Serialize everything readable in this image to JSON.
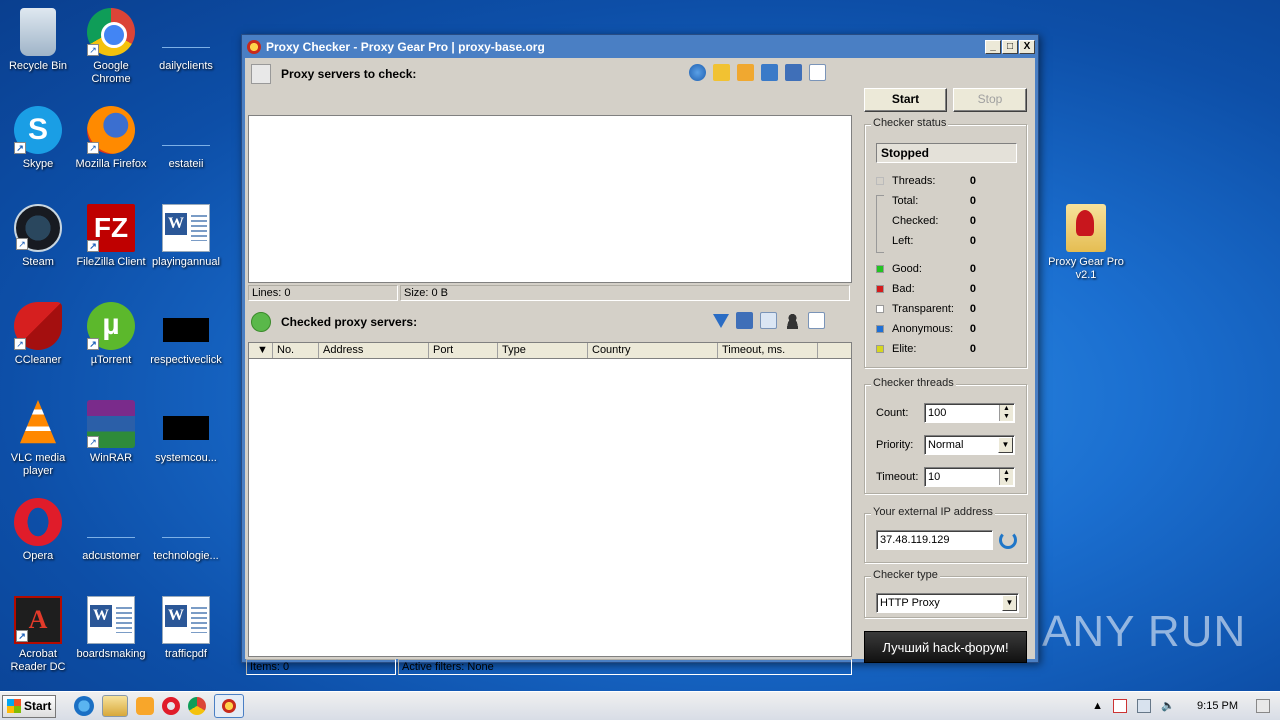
{
  "desktop": {
    "icons": [
      {
        "label": "Recycle Bin"
      },
      {
        "label": "Google Chrome"
      },
      {
        "label": "dailyclients"
      },
      {
        "label": "Skype"
      },
      {
        "label": "Mozilla Firefox"
      },
      {
        "label": "estateii"
      },
      {
        "label": "Steam"
      },
      {
        "label": "FileZilla Client"
      },
      {
        "label": "playingannual"
      },
      {
        "label": "CCleaner"
      },
      {
        "label": "µTorrent"
      },
      {
        "label": "respectiveclick"
      },
      {
        "label": "VLC media player"
      },
      {
        "label": "WinRAR"
      },
      {
        "label": "systemcou..."
      },
      {
        "label": "Opera"
      },
      {
        "label": "adcustomer"
      },
      {
        "label": "technologie..."
      },
      {
        "label": "Acrobat Reader DC"
      },
      {
        "label": "boardsmaking"
      },
      {
        "label": "trafficpdf"
      },
      {
        "label": "Proxy Gear Pro v2.1"
      }
    ]
  },
  "window": {
    "title": "Proxy Checker - Proxy Gear Pro | proxy-base.org",
    "controls": {
      "minimize": "_",
      "maximize": "□",
      "close": "X"
    }
  },
  "proxies_panel": {
    "title": "Proxy servers to check:",
    "status": {
      "lines": "Lines: 0",
      "size": "Size: 0 B"
    }
  },
  "checked_panel": {
    "title": "Checked proxy servers:",
    "columns": [
      "No.",
      "Address",
      "Port",
      "Type",
      "Country",
      "Timeout, ms."
    ],
    "status": {
      "items": "Items: 0",
      "filters": "Active filters: None"
    }
  },
  "controls": {
    "start_label": "Start",
    "stop_label": "Stop"
  },
  "checker_status": {
    "legend": "Checker status",
    "state": "Stopped",
    "counters": [
      {
        "label": "Threads:",
        "value": "0"
      },
      {
        "label": "Total:",
        "value": "0"
      },
      {
        "label": "Checked:",
        "value": "0"
      },
      {
        "label": "Left:",
        "value": "0"
      }
    ],
    "results": [
      {
        "label": "Good:",
        "value": "0",
        "color": "#22c422"
      },
      {
        "label": "Bad:",
        "value": "0",
        "color": "#d41c1c"
      },
      {
        "label": "Transparent:",
        "value": "0",
        "color": "#ffffff"
      },
      {
        "label": "Anonymous:",
        "value": "0",
        "color": "#1e6fd6"
      },
      {
        "label": "Elite:",
        "value": "0",
        "color": "#d6d61e"
      }
    ]
  },
  "checker_threads": {
    "legend": "Checker threads",
    "count_label": "Count:",
    "count_value": "100",
    "priority_label": "Priority:",
    "priority_value": "Normal",
    "timeout_label": "Timeout:",
    "timeout_value": "10"
  },
  "external_ip": {
    "legend": "Your external IP address",
    "value": "37.48.119.129"
  },
  "checker_type": {
    "legend": "Checker type",
    "value": "HTTP Proxy"
  },
  "ad_button": "Лучший hack-форум!",
  "taskbar": {
    "start_label": "Start",
    "clock": "9:15 PM"
  },
  "watermark": "ANY RUN"
}
